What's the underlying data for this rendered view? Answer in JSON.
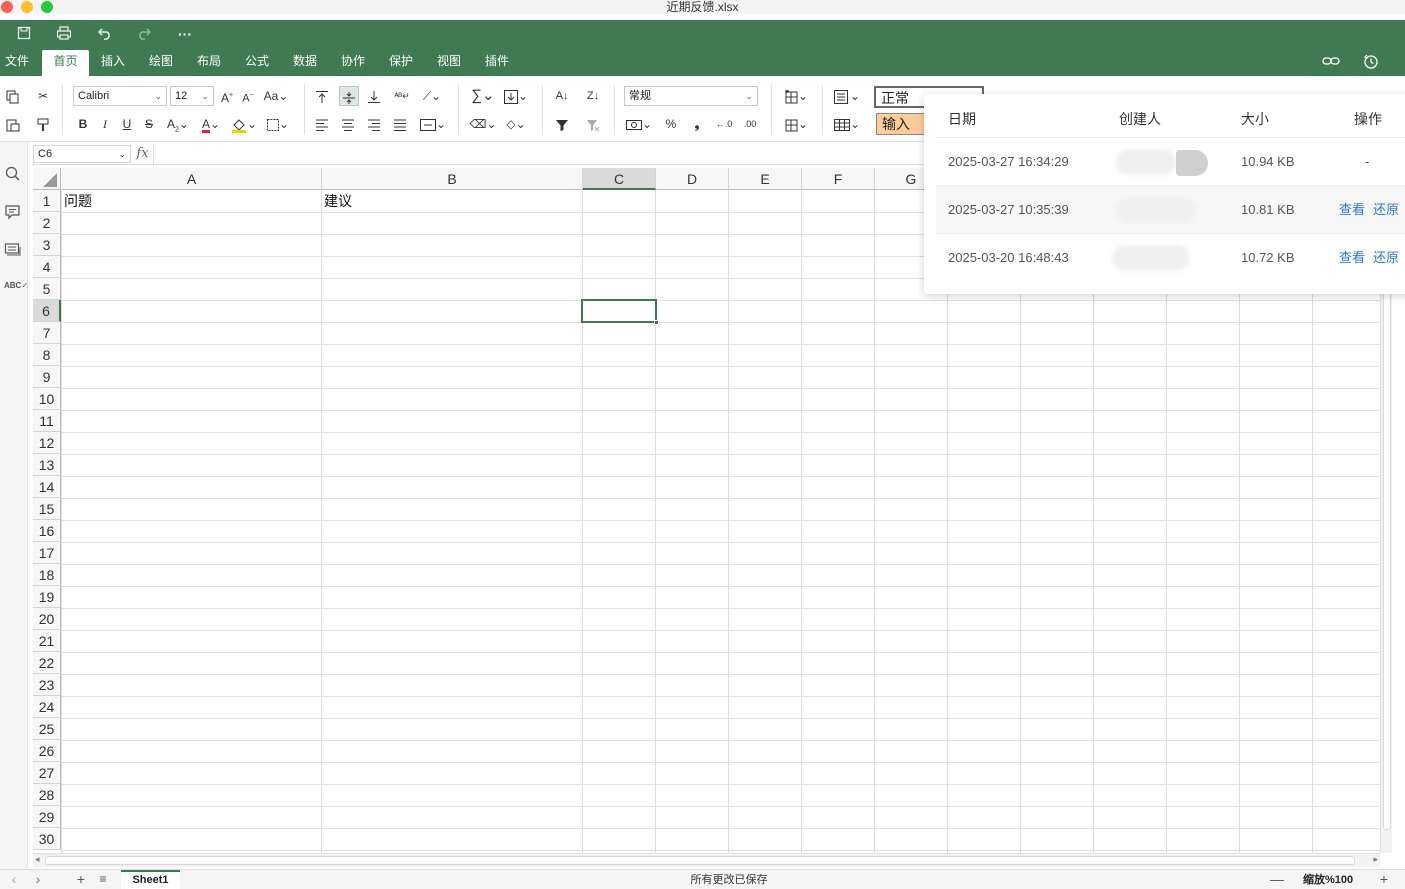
{
  "window": {
    "title": "近期反馈.xlsx"
  },
  "menu": {
    "items": [
      "文件",
      "首页",
      "插入",
      "绘图",
      "布局",
      "公式",
      "数据",
      "协作",
      "保护",
      "视图",
      "插件"
    ],
    "active": "首页"
  },
  "toolbar": {
    "font_name": "Calibri",
    "font_size": "12",
    "number_format": "常规",
    "styles": {
      "normal": "正常",
      "input": "输入"
    },
    "bold": "B",
    "italic": "I",
    "underline": "U",
    "strike": "S",
    "percent": "%",
    "comma": "❟"
  },
  "formula_bar": {
    "cell_ref": "C6",
    "fx": "fx",
    "content": ""
  },
  "sheet": {
    "columns": [
      "A",
      "B",
      "C",
      "D",
      "E",
      "F",
      "G"
    ],
    "selected_column": "C",
    "rows": [
      "1",
      "2",
      "3",
      "4",
      "5",
      "6",
      "7",
      "8",
      "9",
      "10",
      "11",
      "12",
      "13",
      "14",
      "15",
      "16",
      "17",
      "18",
      "19",
      "20",
      "21",
      "22",
      "23",
      "24",
      "25",
      "26",
      "27",
      "28",
      "29",
      "30"
    ],
    "selected_row": "6",
    "cells": {
      "A1": "问题",
      "B1": "建议"
    },
    "selected_cell": "C6"
  },
  "status": {
    "sheet_tab": "Sheet1",
    "save_status": "所有更改已保存",
    "zoom_label": "缩放%100",
    "zoom_out": "—",
    "zoom_in": "+"
  },
  "history": {
    "headers": {
      "date": "日期",
      "creator": "创建人",
      "size": "大小",
      "action": "操作"
    },
    "rows": [
      {
        "date": "2025-03-27 16:34:29",
        "size": "10.94 KB",
        "action": "-"
      },
      {
        "date": "2025-03-27 10:35:39",
        "size": "10.81 KB",
        "view": "查看",
        "restore": "还原"
      },
      {
        "date": "2025-03-20 16:48:43",
        "size": "10.72 KB",
        "view": "查看",
        "restore": "还原"
      }
    ]
  },
  "colors": {
    "brand_green": "#3f7a52",
    "link_blue": "#2a7ad1",
    "input_style_bg": "#fdcc9a"
  }
}
